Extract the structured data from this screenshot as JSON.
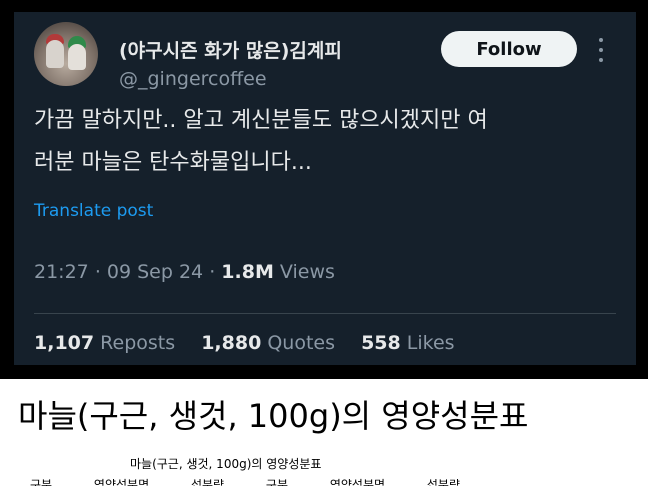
{
  "tweet": {
    "display_name": "(야구시즌 화가 많은)김계피",
    "handle": "@_gingercoffee",
    "follow_label": "Follow",
    "text_line1": "가끔 말하지만.. 알고 계신분들도 많으시겠지만 여",
    "text_line2": "러분 마늘은 탄수화물입니다...",
    "translate_label": "Translate post",
    "time": "21:27",
    "sep": "·",
    "date": "09 Sep 24",
    "views_count": "1.8M",
    "views_label": "Views",
    "reposts_count": "1,107",
    "reposts_label": "Reposts",
    "quotes_count": "1,880",
    "quotes_label": "Quotes",
    "likes_count": "558",
    "likes_label": "Likes"
  },
  "document": {
    "title": "마늘(구근, 생것, 100g)의 영양성분표",
    "table_caption": "마늘(구근, 생것, 100g)의 영양성분표",
    "headers": [
      "구분",
      "영양성분명",
      "섭분량",
      "구분",
      "영양성분명",
      "섭분량"
    ]
  },
  "colors": {
    "background": "#15202b",
    "link": "#1d9bf0",
    "muted": "#8b98a5",
    "text": "#e7e9ea"
  },
  "icons": {
    "more": "more-horizontal-icon"
  }
}
